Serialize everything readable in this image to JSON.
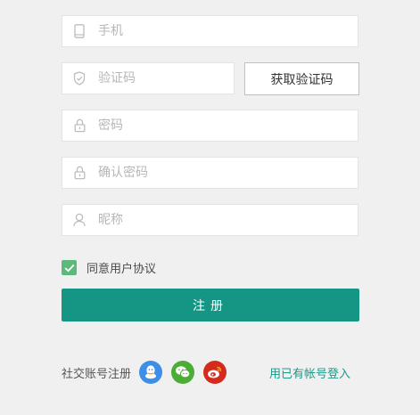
{
  "form": {
    "phone": {
      "placeholder": "手机",
      "icon": "phone-icon"
    },
    "code": {
      "placeholder": "验证码",
      "icon": "shield-icon"
    },
    "get_code_label": "获取验证码",
    "password": {
      "placeholder": "密码",
      "icon": "lock-icon"
    },
    "confirm_password": {
      "placeholder": "确认密码",
      "icon": "lock-icon"
    },
    "nickname": {
      "placeholder": "昵称",
      "icon": "user-icon"
    },
    "agree": {
      "checked": true,
      "label": "同意用户协议"
    },
    "register_label": "注册"
  },
  "social": {
    "label": "社交账号注册",
    "providers": [
      {
        "name": "qq",
        "icon": "qq-icon",
        "color": "#3d8ee6"
      },
      {
        "name": "wechat",
        "icon": "wechat-icon",
        "color": "#4bac36"
      },
      {
        "name": "weibo",
        "icon": "weibo-icon",
        "color": "#d52b1e"
      }
    ],
    "login_link": "用已有帐号登入"
  },
  "colors": {
    "accent": "#159684",
    "checkbox": "#5cb87b",
    "link": "#1a9a86"
  }
}
